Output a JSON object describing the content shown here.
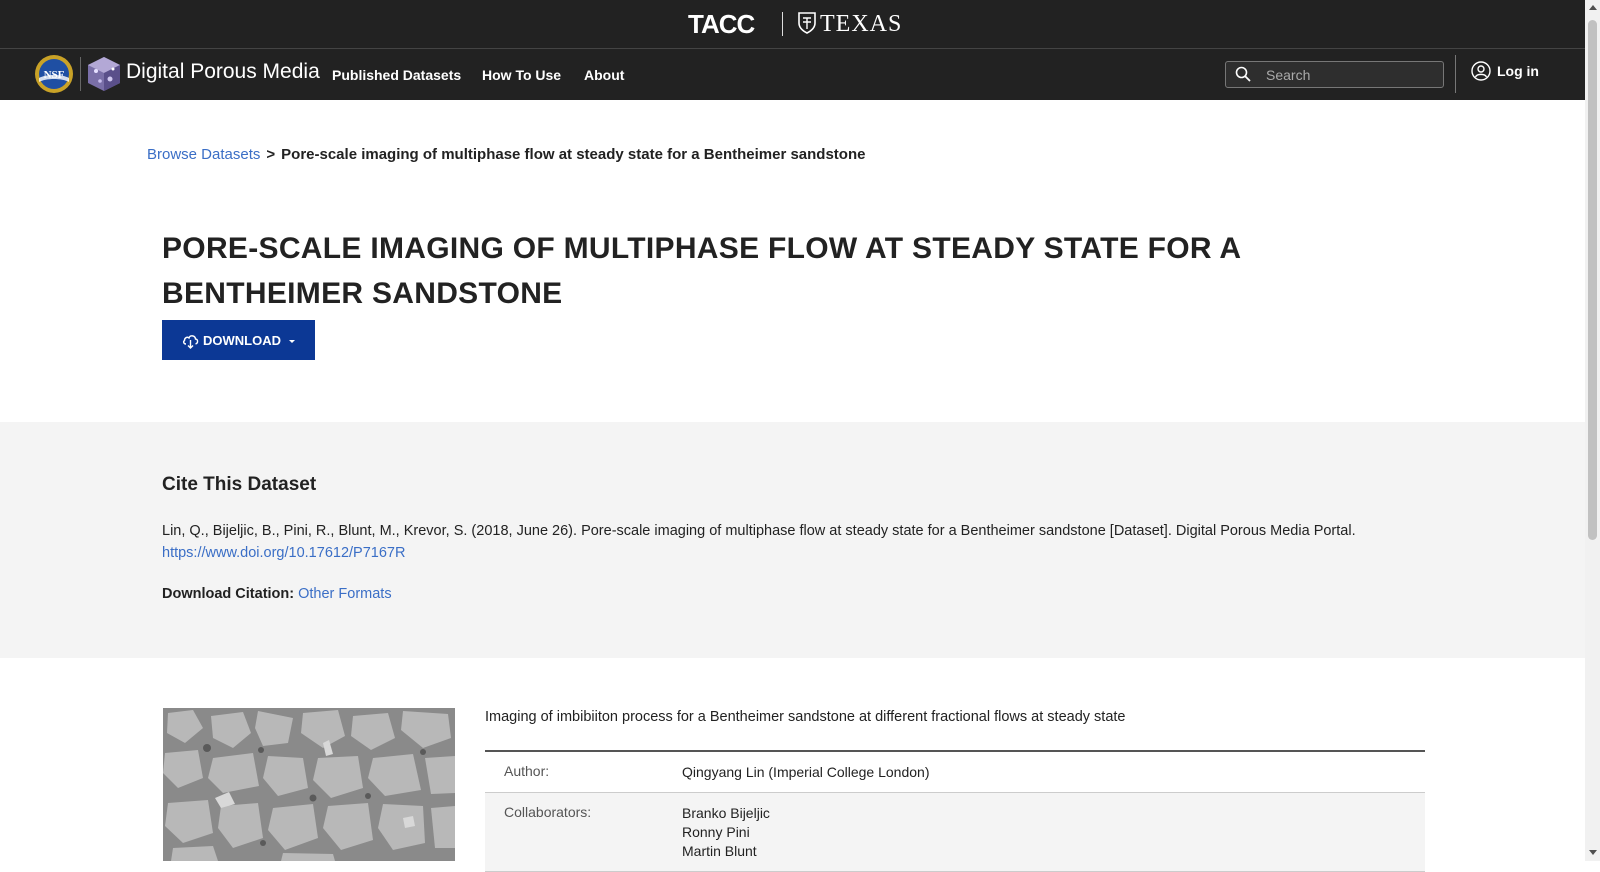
{
  "header": {
    "tacc_logo_text": "TACC",
    "texas_logo_text": "TEXAS"
  },
  "nav": {
    "brand": "Digital Porous Media",
    "links": [
      "Published Datasets",
      "How To Use",
      "About"
    ],
    "search_placeholder": "Search",
    "login_label": "Log in"
  },
  "breadcrumb": {
    "parent": "Browse Datasets",
    "separator": ">",
    "current": "Pore-scale imaging of multiphase flow at steady state for a Bentheimer sandstone"
  },
  "dataset": {
    "title": "Pore-scale imaging of multiphase flow at steady state for a Bentheimer sandstone",
    "download_label": "DOWNLOAD",
    "description": "Imaging of imbibiiton process for a Bentheimer sandstone at different fractional flows at steady state"
  },
  "cite": {
    "heading": "Cite This Dataset",
    "citation": "Lin, Q., Bijeljic, B., Pini, R., Blunt, M., Krevor, S. (2018, June 26). Pore-scale imaging of multiphase flow at steady state for a Bentheimer sandstone [Dataset]. Digital Porous Media Portal.",
    "doi_link": "https://www.doi.org/10.17612/P7167R",
    "download_label": "Download Citation:",
    "other_formats": "Other Formats"
  },
  "metadata": {
    "author_label": "Author:",
    "author_value": "Qingyang Lin (Imperial College London)",
    "collaborators_label": "Collaborators:",
    "collaborators": [
      "Branko Bijeljic",
      "Ronny Pini",
      "Martin Blunt"
    ]
  },
  "colors": {
    "header_bg": "#222222",
    "accent_button": "#0c3895",
    "link": "#3a6ec6",
    "cite_bg": "#f4f4f4"
  }
}
